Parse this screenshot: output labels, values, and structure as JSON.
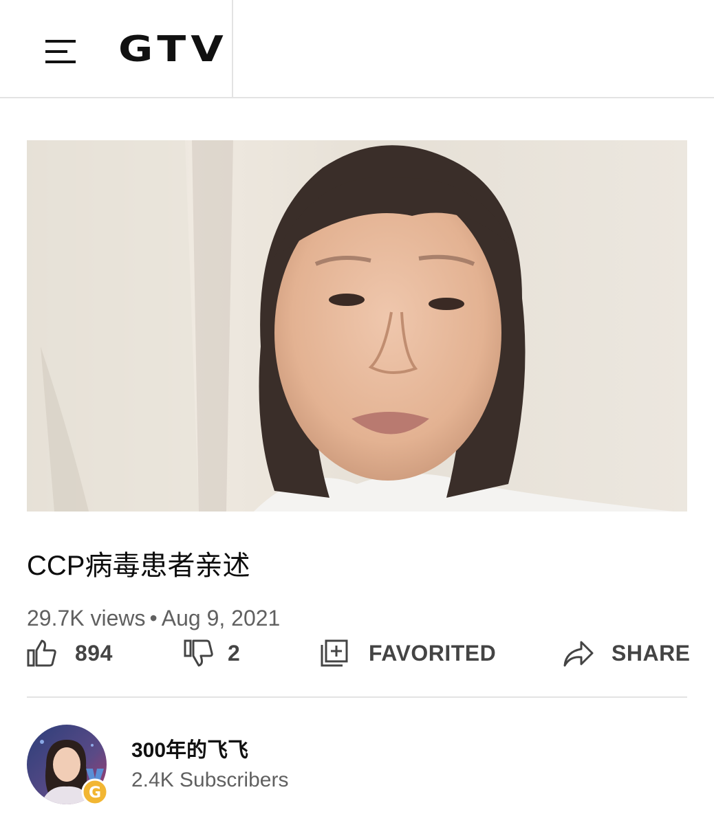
{
  "header": {
    "logo": "GTV"
  },
  "video": {
    "title": "CCP病毒患者亲述",
    "views": "29.7K views",
    "separator": "•",
    "date": "Aug 9, 2021"
  },
  "actions": {
    "likes": "894",
    "dislikes": "2",
    "favorite_label": "FAVORITED",
    "share_label": "SHARE"
  },
  "channel": {
    "name": "300年的飞飞",
    "subscribers": "2.4K Subscribers",
    "badge_letter": "G"
  },
  "icons": {
    "menu": "hamburger-menu-icon",
    "like": "thumbs-up-icon",
    "dislike": "thumbs-down-icon",
    "favorite": "add-to-playlist-icon",
    "share": "share-arrow-icon",
    "badge": "medal-badge-icon"
  },
  "colors": {
    "text_primary": "#111111",
    "text_secondary": "#606060",
    "divider": "#e3e3e3",
    "badge_gold": "#f2b632",
    "badge_ribbon": "#5a8fd6"
  }
}
